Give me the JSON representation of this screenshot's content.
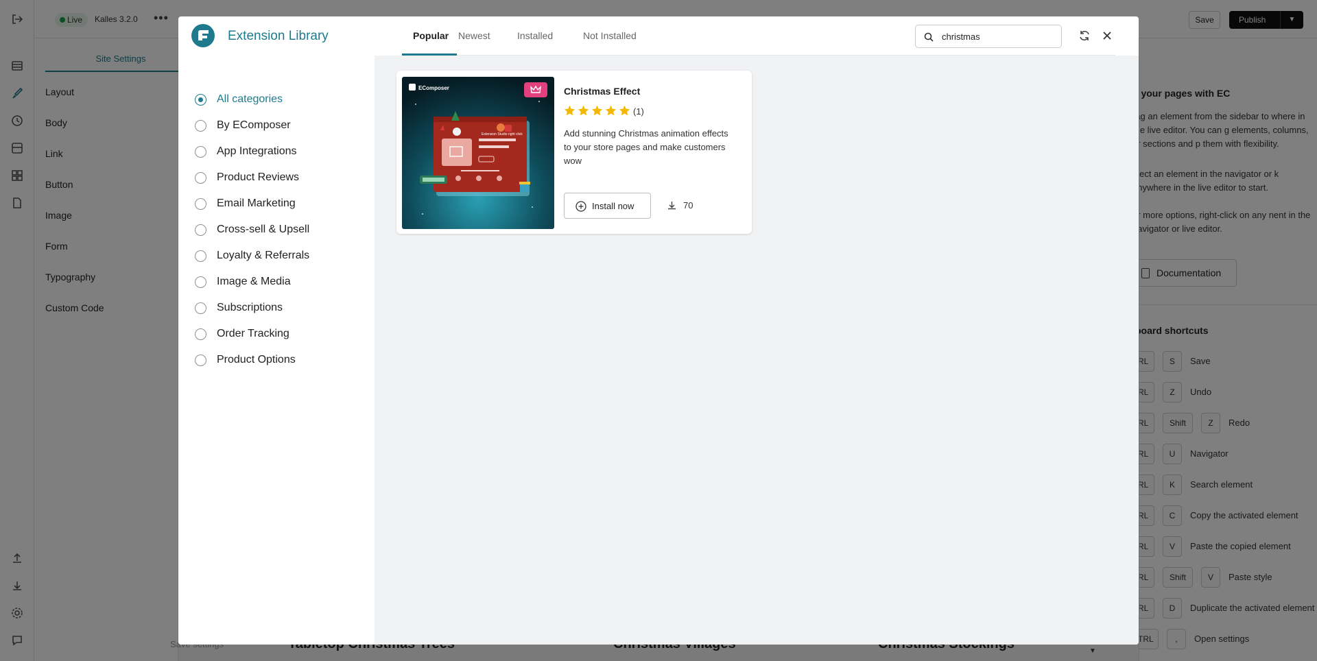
{
  "editor": {
    "live_label": "Live",
    "theme_name": "Kalles 3.2.0",
    "more_label": "•••",
    "save_label": "Save",
    "publish_label": "Publish",
    "site_settings_tab": "Site Settings",
    "settings_items": [
      "Layout",
      "Body",
      "Link",
      "Button",
      "Image",
      "Form",
      "Typography",
      "Custom Code"
    ],
    "save_settings_label": "Save settings",
    "help": {
      "title": "d your pages with EC",
      "p1": "rag an element from the sidebar to where in the live editor. You can g elements, columns, or sections and p them with flexibility.",
      "p2": "elect an element in the navigator or k anywhere in the live editor to start.",
      "p3": "or more options, right-click on any nent in the navigator or live editor.",
      "documentation_label": "Documentation",
      "shortcuts_title": "board shortcuts",
      "shortcuts": [
        {
          "keys": [
            "TRL",
            "S"
          ],
          "label": "Save"
        },
        {
          "keys": [
            "TRL",
            "Z"
          ],
          "label": "Undo"
        },
        {
          "keys": [
            "TRL",
            "Shift",
            "Z"
          ],
          "label": "Redo"
        },
        {
          "keys": [
            "TRL",
            "U"
          ],
          "label": "Navigator"
        },
        {
          "keys": [
            "TRL",
            "K"
          ],
          "label": "Search element"
        },
        {
          "keys": [
            "TRL",
            "C"
          ],
          "label": "Copy the activated element"
        },
        {
          "keys": [
            "TRL",
            "V"
          ],
          "label": "Paste the copied element"
        },
        {
          "keys": [
            "TRL",
            "Shift",
            "V"
          ],
          "label": "Paste style"
        },
        {
          "keys": [
            "TRL",
            "D"
          ],
          "label": "Duplicate the activated element"
        },
        {
          "keys": [
            "CTRL",
            ","
          ],
          "label": "Open settings"
        }
      ]
    },
    "bottom_products": [
      "Tabletop Christmas Trees",
      "Christmas Villages",
      "Christmas Stockings"
    ]
  },
  "modal": {
    "title": "Extension Library",
    "tabs": [
      {
        "label": "Popular",
        "active": true
      },
      {
        "label": "Newest",
        "active": false
      },
      {
        "label": "Installed",
        "active": false
      },
      {
        "label": "Not Installed",
        "active": false
      }
    ],
    "search": {
      "value": "christmas",
      "placeholder": "Search"
    },
    "categories": [
      {
        "label": "All categories",
        "selected": true
      },
      {
        "label": "By EComposer",
        "selected": false
      },
      {
        "label": "App Integrations",
        "selected": false
      },
      {
        "label": "Product Reviews",
        "selected": false
      },
      {
        "label": "Email Marketing",
        "selected": false
      },
      {
        "label": "Cross-sell & Upsell",
        "selected": false
      },
      {
        "label": "Loyalty & Referrals",
        "selected": false
      },
      {
        "label": "Image & Media",
        "selected": false
      },
      {
        "label": "Subscriptions",
        "selected": false
      },
      {
        "label": "Order Tracking",
        "selected": false
      },
      {
        "label": "Product Options",
        "selected": false
      }
    ],
    "results": [
      {
        "title": "Christmas Effect",
        "rating": 5,
        "rating_count": "(1)",
        "description": "Add stunning Christmas animation effects to your store pages and make customers wow",
        "install_label": "Install now",
        "downloads": "70",
        "thumb_brand": "EComposer",
        "thumb_caption": "Extension Studio right click"
      }
    ]
  },
  "colors": {
    "accent": "#1e7a8c",
    "star": "#f5b800",
    "pro_badge": "#e2407e",
    "thumb_card": "#a3281d"
  }
}
